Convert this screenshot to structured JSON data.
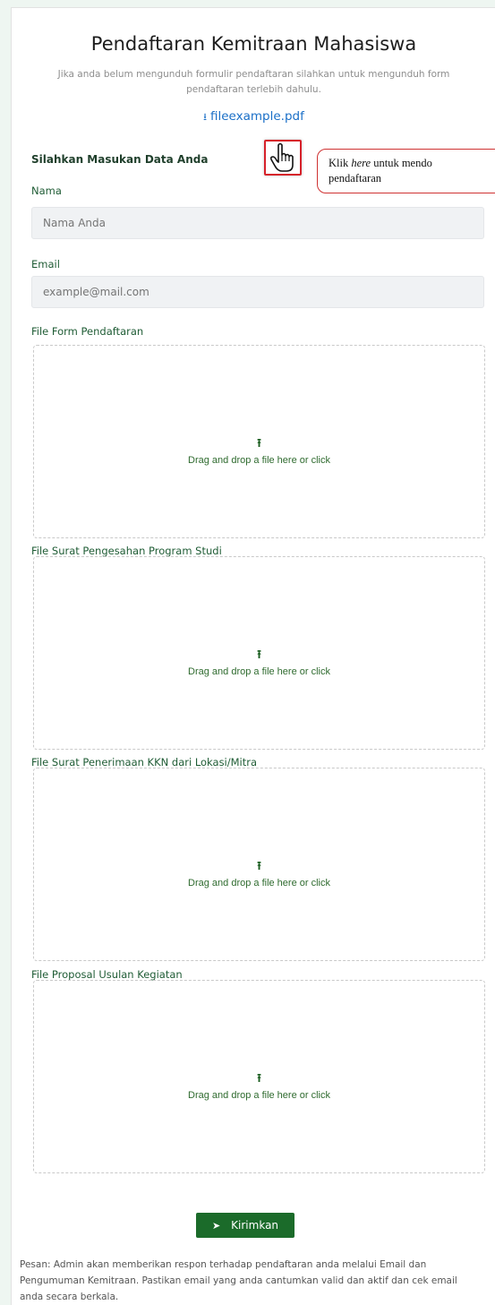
{
  "header": {
    "title": "Pendaftaran Kemitraan Mahasiswa",
    "subtitle": "Jika anda belum mengunduh formulir pendaftaran silahkan untuk mengunduh form pendaftaran terlebih dahulu.",
    "file_link_icon": "⭳",
    "file_link": "fileexample.pdf"
  },
  "form": {
    "section_title": "Silahkan Masukan Data Anda",
    "name_label": "Nama",
    "name_placeholder": "Nama Anda",
    "email_label": "Email",
    "email_placeholder": "example@mail.com",
    "upload_icon": "⭱",
    "uploads": [
      {
        "label": "File Form Pendaftaran",
        "text": "Drag and drop a file here or click"
      },
      {
        "label": "File Surat Pengesahan Program Studi",
        "text": "Drag and drop a file here or click"
      },
      {
        "label": "File Surat Penerimaan KKN dari Lokasi/Mitra",
        "text": "Drag and drop a file here or click"
      },
      {
        "label": "File Proposal Usulan Kegiatan",
        "text": "Drag and drop a file here or click"
      }
    ],
    "submit_icon": "➤",
    "submit_label": "Kirimkan",
    "message": "Pesan: Admin akan memberikan respon terhadap pendaftaran anda melalui Email dan Pengumuman Kemitraan. Pastikan email yang anda cantumkan valid dan aktif dan cek email anda secara berkala."
  },
  "tutorial": {
    "hand_icon": "☝",
    "tip_prefix": "Klik ",
    "tip_emphasis": "here",
    "tip_line1_rest": " untuk mendo",
    "tip_line2": "pendaftaran"
  }
}
